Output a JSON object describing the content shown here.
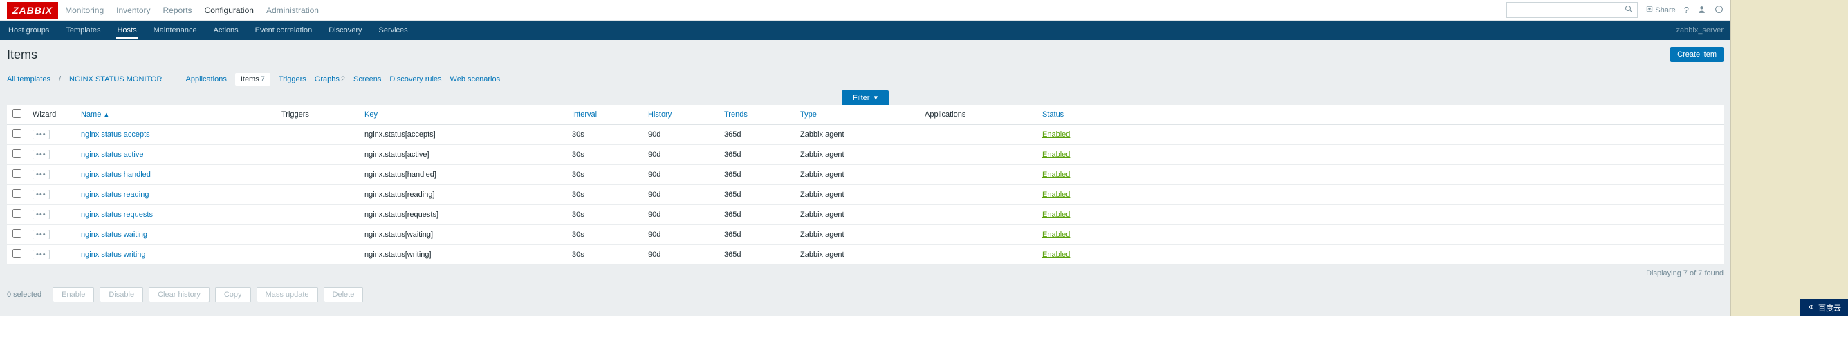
{
  "brand": "ZABBIX",
  "topnav": {
    "items": [
      "Monitoring",
      "Inventory",
      "Reports",
      "Configuration",
      "Administration"
    ],
    "active": "Configuration",
    "share": "Share"
  },
  "subnav": {
    "items": [
      "Host groups",
      "Templates",
      "Hosts",
      "Maintenance",
      "Actions",
      "Event correlation",
      "Discovery",
      "Services"
    ],
    "active": "Hosts",
    "server_label": "zabbix_server"
  },
  "page": {
    "title": "Items",
    "create_btn": "Create item"
  },
  "breadcrumb": {
    "all_templates": "All templates",
    "template_name": "NGINX STATUS MONITOR",
    "tabs": [
      {
        "label": "Applications",
        "count": null
      },
      {
        "label": "Items",
        "count": "7",
        "active": true
      },
      {
        "label": "Triggers",
        "count": null
      },
      {
        "label": "Graphs",
        "count": "2"
      },
      {
        "label": "Screens",
        "count": null
      },
      {
        "label": "Discovery rules",
        "count": null
      },
      {
        "label": "Web scenarios",
        "count": null
      }
    ]
  },
  "filter_label": "Filter",
  "table": {
    "headers": {
      "wizard": "Wizard",
      "name": "Name",
      "triggers": "Triggers",
      "key": "Key",
      "interval": "Interval",
      "history": "History",
      "trends": "Trends",
      "type": "Type",
      "applications": "Applications",
      "status": "Status"
    },
    "rows": [
      {
        "name": "nginx status accepts",
        "key": "nginx.status[accepts]",
        "interval": "30s",
        "history": "90d",
        "trends": "365d",
        "type": "Zabbix agent",
        "status": "Enabled"
      },
      {
        "name": "nginx status active",
        "key": "nginx.status[active]",
        "interval": "30s",
        "history": "90d",
        "trends": "365d",
        "type": "Zabbix agent",
        "status": "Enabled"
      },
      {
        "name": "nginx status handled",
        "key": "nginx.status[handled]",
        "interval": "30s",
        "history": "90d",
        "trends": "365d",
        "type": "Zabbix agent",
        "status": "Enabled"
      },
      {
        "name": "nginx status reading",
        "key": "nginx.status[reading]",
        "interval": "30s",
        "history": "90d",
        "trends": "365d",
        "type": "Zabbix agent",
        "status": "Enabled"
      },
      {
        "name": "nginx status requests",
        "key": "nginx.status[requests]",
        "interval": "30s",
        "history": "90d",
        "trends": "365d",
        "type": "Zabbix agent",
        "status": "Enabled"
      },
      {
        "name": "nginx status waiting",
        "key": "nginx.status[waiting]",
        "interval": "30s",
        "history": "90d",
        "trends": "365d",
        "type": "Zabbix agent",
        "status": "Enabled"
      },
      {
        "name": "nginx status writing",
        "key": "nginx.status[writing]",
        "interval": "30s",
        "history": "90d",
        "trends": "365d",
        "type": "Zabbix agent",
        "status": "Enabled"
      }
    ]
  },
  "display_count": "Displaying 7 of 7 found",
  "footer": {
    "selected": "0 selected",
    "buttons": [
      "Enable",
      "Disable",
      "Clear history",
      "Copy",
      "Mass update",
      "Delete"
    ]
  },
  "gutter_badge": "百度云"
}
